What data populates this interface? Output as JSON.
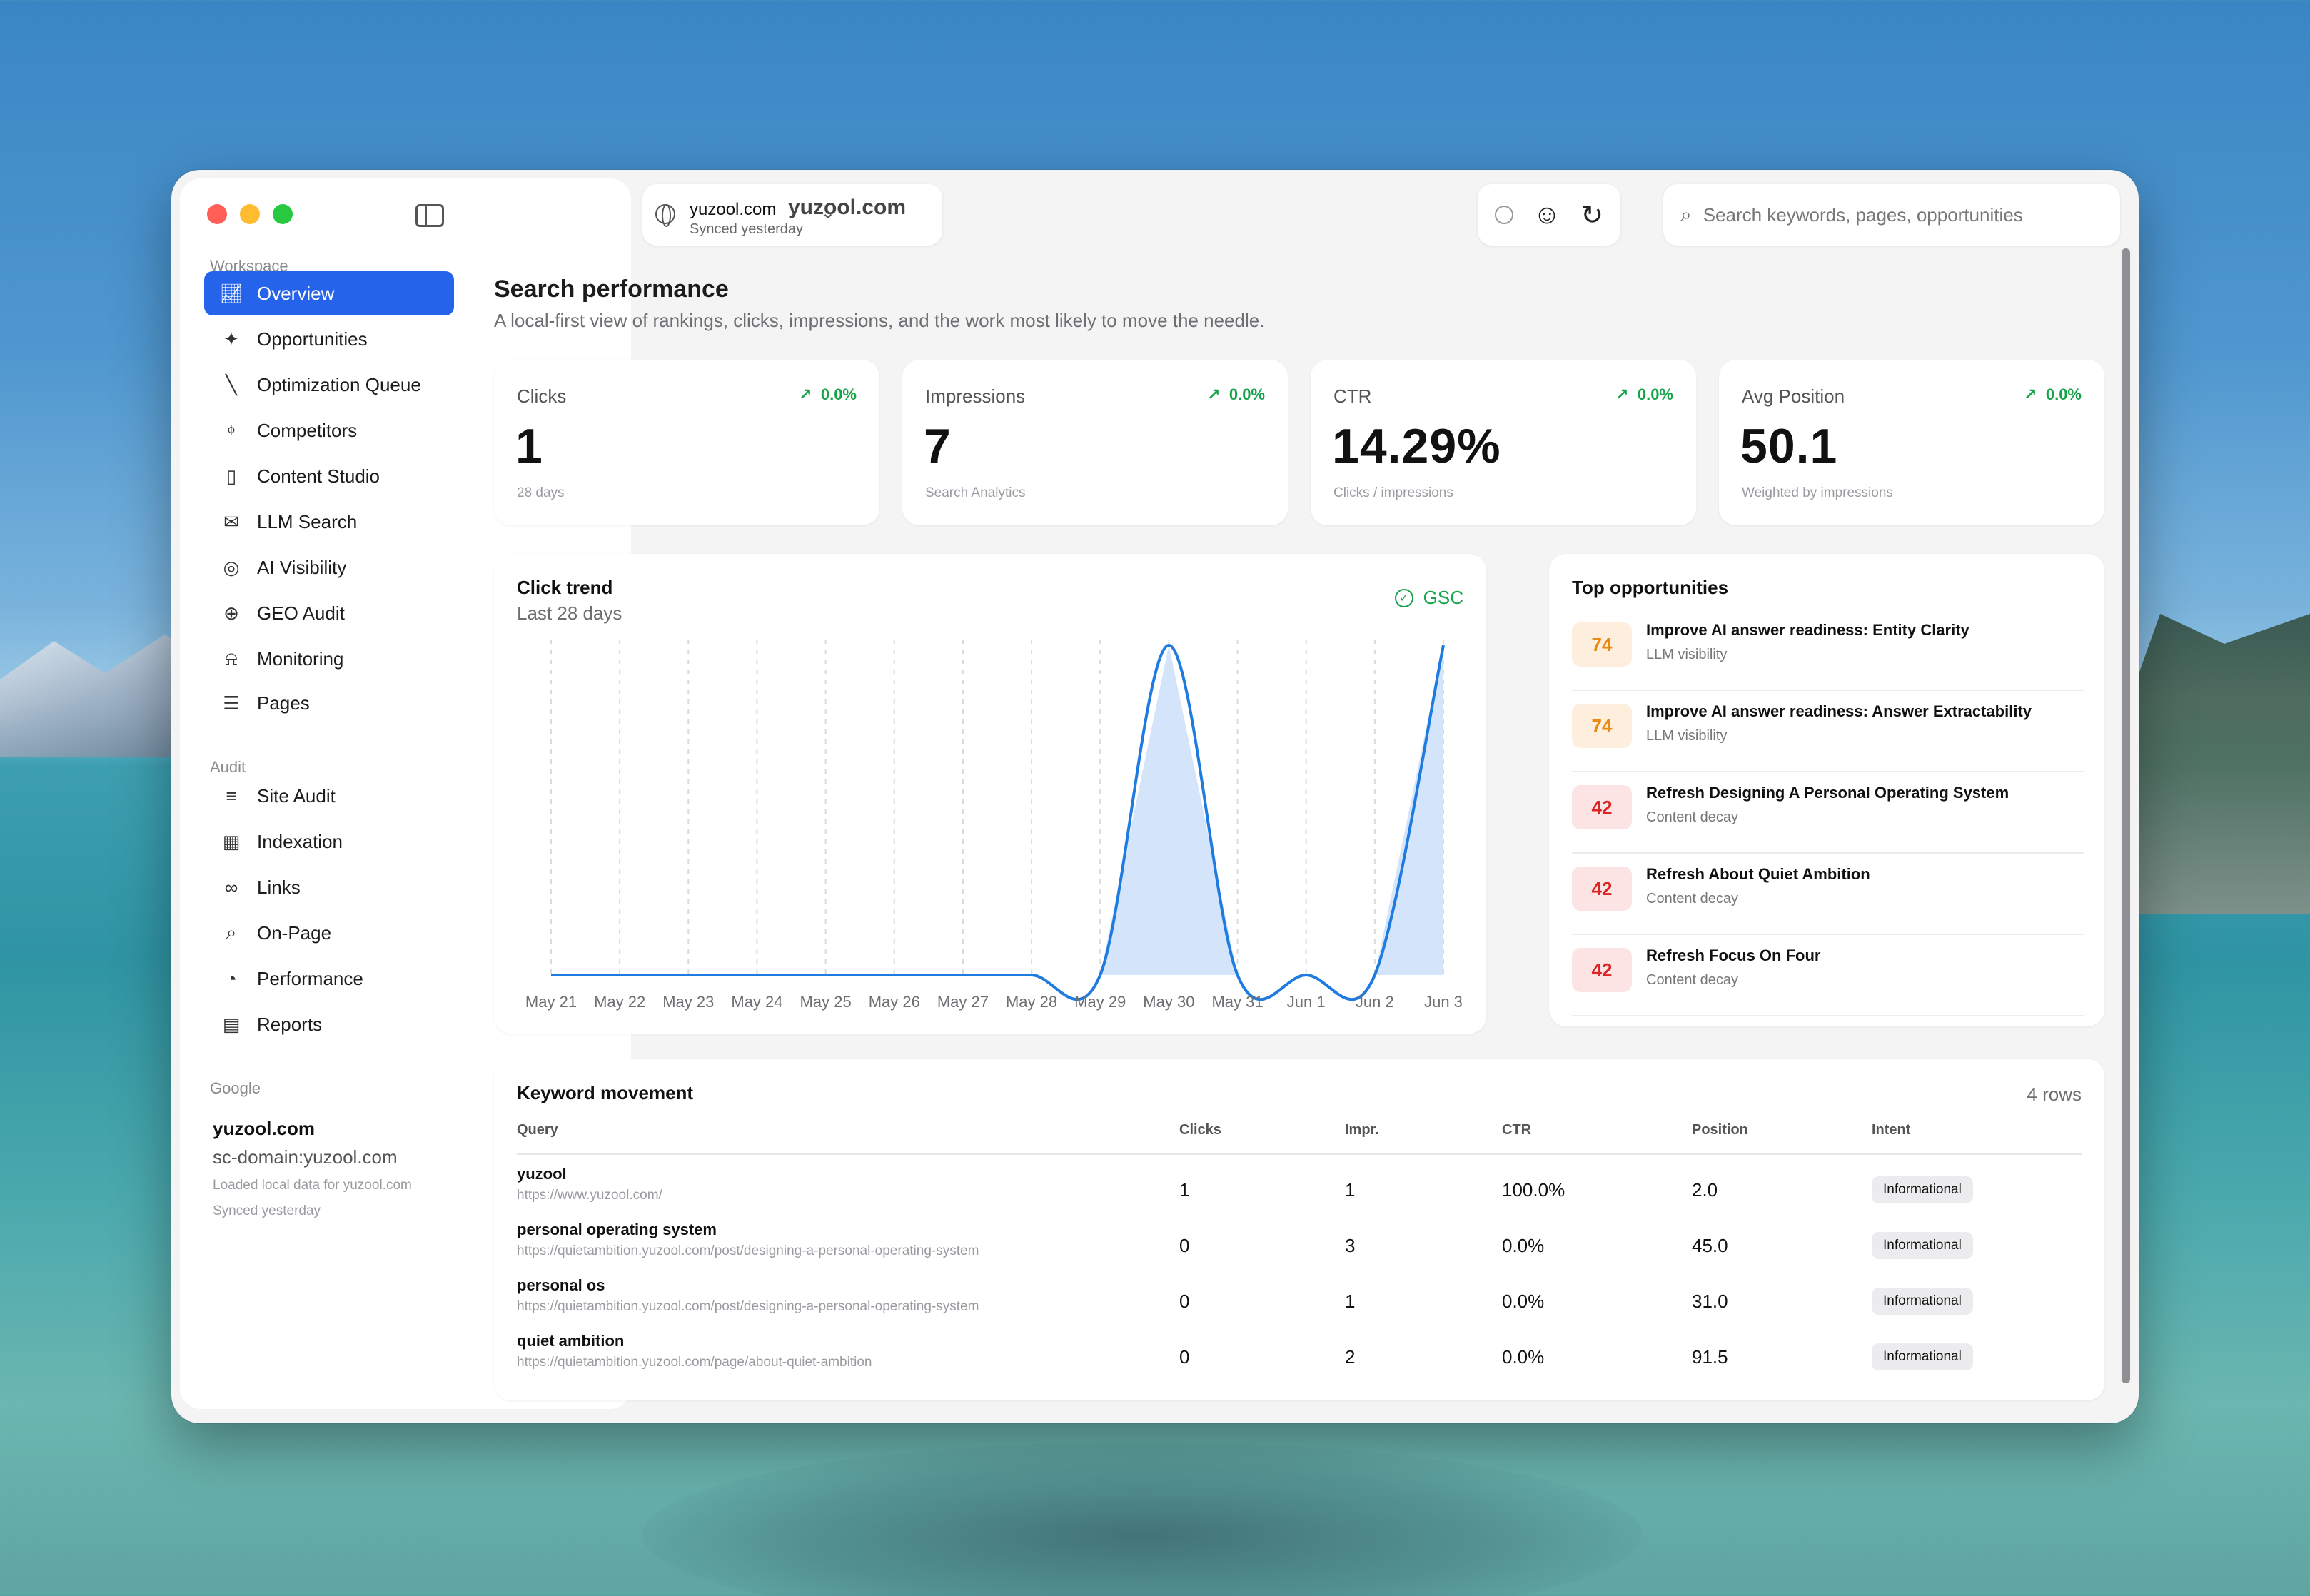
{
  "sidebar": {
    "workspace_label": "Workspace",
    "workspace_items": [
      {
        "label": "Overview"
      },
      {
        "label": "Opportunities"
      },
      {
        "label": "Optimization Queue"
      },
      {
        "label": "Competitors"
      },
      {
        "label": "Content Studio"
      },
      {
        "label": "LLM Search"
      },
      {
        "label": "AI Visibility"
      },
      {
        "label": "GEO Audit"
      },
      {
        "label": "Monitoring"
      },
      {
        "label": "Pages"
      }
    ],
    "audit_label": "Audit",
    "audit_items": [
      {
        "label": "Site Audit"
      },
      {
        "label": "Indexation"
      },
      {
        "label": "Links"
      },
      {
        "label": "On-Page"
      },
      {
        "label": "Performance"
      },
      {
        "label": "Reports"
      }
    ],
    "google_label": "Google",
    "google": {
      "domain": "yuzool.com",
      "property": "sc-domain:yuzool.com",
      "loaded": "Loaded local data for yuzool.com",
      "synced": "Synced yesterday"
    }
  },
  "topbar": {
    "site_name": "yuzool.com",
    "site_sync": "Synced yesterday",
    "title": "yuzool.com",
    "search_placeholder": "Search keywords, pages, opportunities"
  },
  "page": {
    "title": "Search performance",
    "subtitle": "A local-first view of rankings, clicks, impressions, and the work most likely to move the needle."
  },
  "kpis": [
    {
      "label": "Clicks",
      "delta": "0.0%",
      "value": "1",
      "note": "28 days"
    },
    {
      "label": "Impressions",
      "delta": "0.0%",
      "value": "7",
      "note": "Search Analytics"
    },
    {
      "label": "CTR",
      "delta": "0.0%",
      "value": "14.29%",
      "note": "Clicks / impressions"
    },
    {
      "label": "Avg Position",
      "delta": "0.0%",
      "value": "50.1",
      "note": "Weighted by impressions"
    }
  ],
  "click_trend": {
    "title": "Click trend",
    "subtitle": "Last 28 days",
    "badge": "GSC"
  },
  "chart_data": {
    "type": "area",
    "title": "Click trend",
    "subtitle": "Last 28 days",
    "x": [
      "May 21",
      "May 22",
      "May 23",
      "May 24",
      "May 25",
      "May 26",
      "May 27",
      "May 28",
      "May 29",
      "May 30",
      "May 31",
      "Jun 1",
      "Jun 2",
      "Jun 3"
    ],
    "tick_labels": [
      "May 21",
      "May 22",
      "May 23",
      "May 24",
      "May 25",
      "May 26",
      "May 27",
      "May 28",
      "May 29",
      "May 30",
      "May 31",
      "Jun 1",
      "Jun 2",
      "Jun 3"
    ],
    "series": [
      {
        "values": [
          0,
          0,
          0,
          0,
          0,
          0,
          0,
          0,
          0,
          1,
          0,
          0,
          0,
          1
        ]
      }
    ],
    "ylim": [
      0,
      1
    ],
    "grid": "vertical-dashed",
    "colors": {
      "line": "#1e7be0",
      "fill": "#cfe2fb"
    }
  },
  "opportunities": {
    "title": "Top opportunities",
    "items": [
      {
        "score": "74",
        "level": "orange",
        "title": "Improve AI answer readiness: Entity Clarity",
        "category": "LLM visibility"
      },
      {
        "score": "74",
        "level": "orange",
        "title": "Improve AI answer readiness: Answer Extractability",
        "category": "LLM visibility"
      },
      {
        "score": "42",
        "level": "red",
        "title": "Refresh Designing A Personal Operating System",
        "category": "Content decay"
      },
      {
        "score": "42",
        "level": "red",
        "title": "Refresh About Quiet Ambition",
        "category": "Content decay"
      },
      {
        "score": "42",
        "level": "red",
        "title": "Refresh Focus On Four",
        "category": "Content decay"
      }
    ]
  },
  "keywords": {
    "title": "Keyword movement",
    "row_count": "4 rows",
    "headers": {
      "query": "Query",
      "clicks": "Clicks",
      "impr": "Impr.",
      "ctr": "CTR",
      "position": "Position",
      "intent": "Intent"
    },
    "rows": [
      {
        "query": "yuzool",
        "url": "https://www.yuzool.com/",
        "clicks": "1",
        "impr": "1",
        "ctr": "100.0%",
        "position": "2.0",
        "intent": "Informational"
      },
      {
        "query": "personal operating system",
        "url": "https://quietambition.yuzool.com/post/designing-a-personal-operating-system",
        "clicks": "0",
        "impr": "3",
        "ctr": "0.0%",
        "position": "45.0",
        "intent": "Informational"
      },
      {
        "query": "personal os",
        "url": "https://quietambition.yuzool.com/post/designing-a-personal-operating-system",
        "clicks": "0",
        "impr": "1",
        "ctr": "0.0%",
        "position": "31.0",
        "intent": "Informational"
      },
      {
        "query": "quiet ambition",
        "url": "https://quietambition.yuzool.com/page/about-quiet-ambition",
        "clicks": "0",
        "impr": "2",
        "ctr": "0.0%",
        "position": "91.5",
        "intent": "Informational"
      }
    ]
  }
}
